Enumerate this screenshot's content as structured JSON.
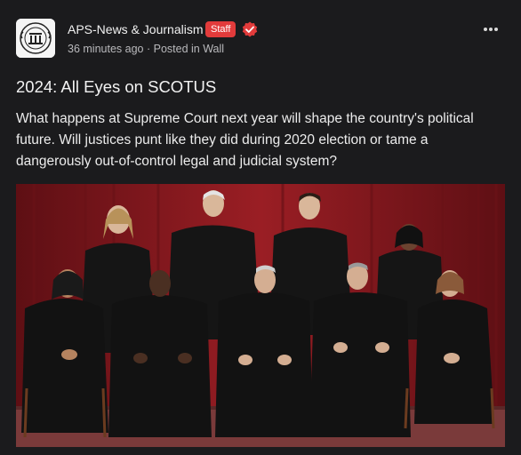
{
  "post": {
    "author": "APS-News & Journalism",
    "badge": "Staff",
    "time": "36 minutes ago",
    "separator": "·",
    "posted_in": "Posted in Wall",
    "title": "2024: All Eyes on SCOTUS",
    "body": "What happens at Supreme Court next year will shape the country's political future. Will justices punt like they did during 2020 election or tame a dangerously out-of-control legal and judicial system?"
  },
  "icons": {
    "avatar": "news-seal-logo",
    "verified": "verified-check-icon",
    "more": "more-options-icon"
  },
  "colors": {
    "badge": "#e23b3b",
    "background": "#1b1b1d",
    "curtain": "#8e1a1f"
  }
}
